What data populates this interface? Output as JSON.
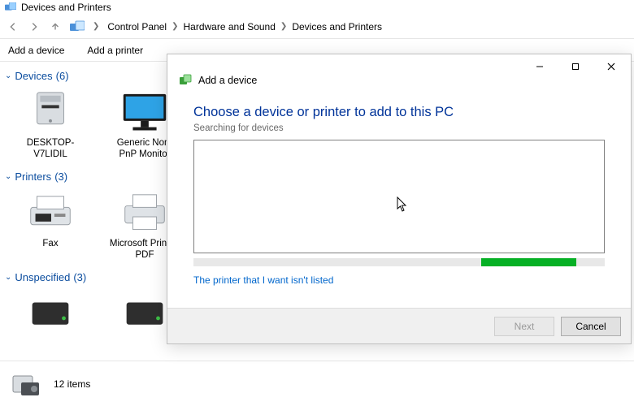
{
  "window": {
    "title": "Devices and Printers"
  },
  "nav": {
    "crumbs": [
      "Control Panel",
      "Hardware and Sound",
      "Devices and Printers"
    ]
  },
  "commands": {
    "add_device": "Add a device",
    "add_printer": "Add a printer"
  },
  "groups": {
    "devices": {
      "label": "Devices",
      "count": "(6)"
    },
    "printers": {
      "label": "Printers",
      "count": "(3)"
    },
    "unspecified": {
      "label": "Unspecified",
      "count": "(3)"
    }
  },
  "devices": {
    "desktop": "DESKTOP-V7LIDIL",
    "monitor": "Generic Non-PnP Monitor",
    "fax": "Fax",
    "msprint": "Microsoft Print to PDF"
  },
  "status": {
    "items": "12 items"
  },
  "dialog": {
    "title": "Add a device",
    "heading": "Choose a device or printer to add to this PC",
    "sub": "Searching for devices",
    "link": "The printer that I want isn't listed",
    "next": "Next",
    "cancel": "Cancel",
    "progress_left_pct": "70",
    "progress_width_pct": "23"
  }
}
